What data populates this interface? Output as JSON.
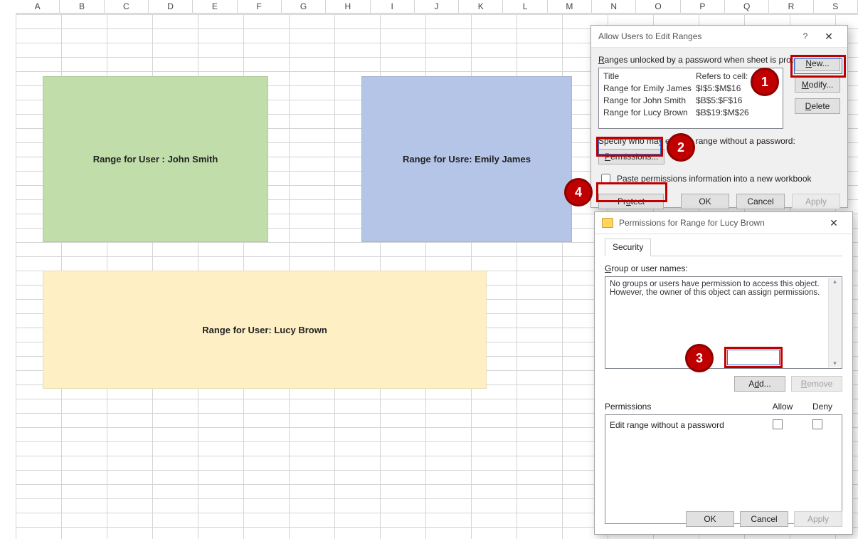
{
  "columns": [
    "A",
    "B",
    "C",
    "D",
    "E",
    "F",
    "G",
    "H",
    "I",
    "J",
    "K",
    "L",
    "M",
    "N",
    "O",
    "P",
    "Q",
    "R",
    "S"
  ],
  "ranges": {
    "green_label": "Range for User : John Smith",
    "blue_label": "Range for Usre: Emily James",
    "yellow_label": "Range for User: Lucy Brown"
  },
  "dlg1": {
    "title": "Allow Users to Edit Ranges",
    "help": "?",
    "close": "✕",
    "ranges_label_text": "Ranges unlocked by a password when sheet is protected:",
    "col_title": "Title",
    "col_refers": "Refers to cell:",
    "rows": [
      {
        "title": "Range for Emily James",
        "ref": "$I$5:$M$16"
      },
      {
        "title": "Range for John Smith",
        "ref": "$B$5:$F$16"
      },
      {
        "title": "Range for Lucy Brown",
        "ref": "$B$19:$M$26"
      }
    ],
    "btn_new": "New...",
    "btn_modify": "Modify...",
    "btn_delete": "Delete",
    "spec_label": "Specify who may edit the range without a password:",
    "btn_permissions": "Permissions...",
    "paste_label": "Paste permissions information into a new workbook",
    "btn_protect": "Protect Sheet...",
    "btn_ok": "OK",
    "btn_cancel": "Cancel",
    "btn_apply": "Apply"
  },
  "dlg2": {
    "title": "Permissions for Range for Lucy Brown",
    "close": "✕",
    "tab_security": "Security",
    "group_label": "Group or user names:",
    "names_text": "No groups or users have permission to access this object. However, the owner of this object can assign permissions.",
    "btn_add": "Add...",
    "btn_remove": "Remove",
    "perm_label": "Permissions",
    "col_allow": "Allow",
    "col_deny": "Deny",
    "perm_entry": "Edit range without a password",
    "btn_ok": "OK",
    "btn_cancel": "Cancel",
    "btn_apply": "Apply"
  },
  "callouts": {
    "c1": "1",
    "c2": "2",
    "c3": "3",
    "c4": "4"
  }
}
